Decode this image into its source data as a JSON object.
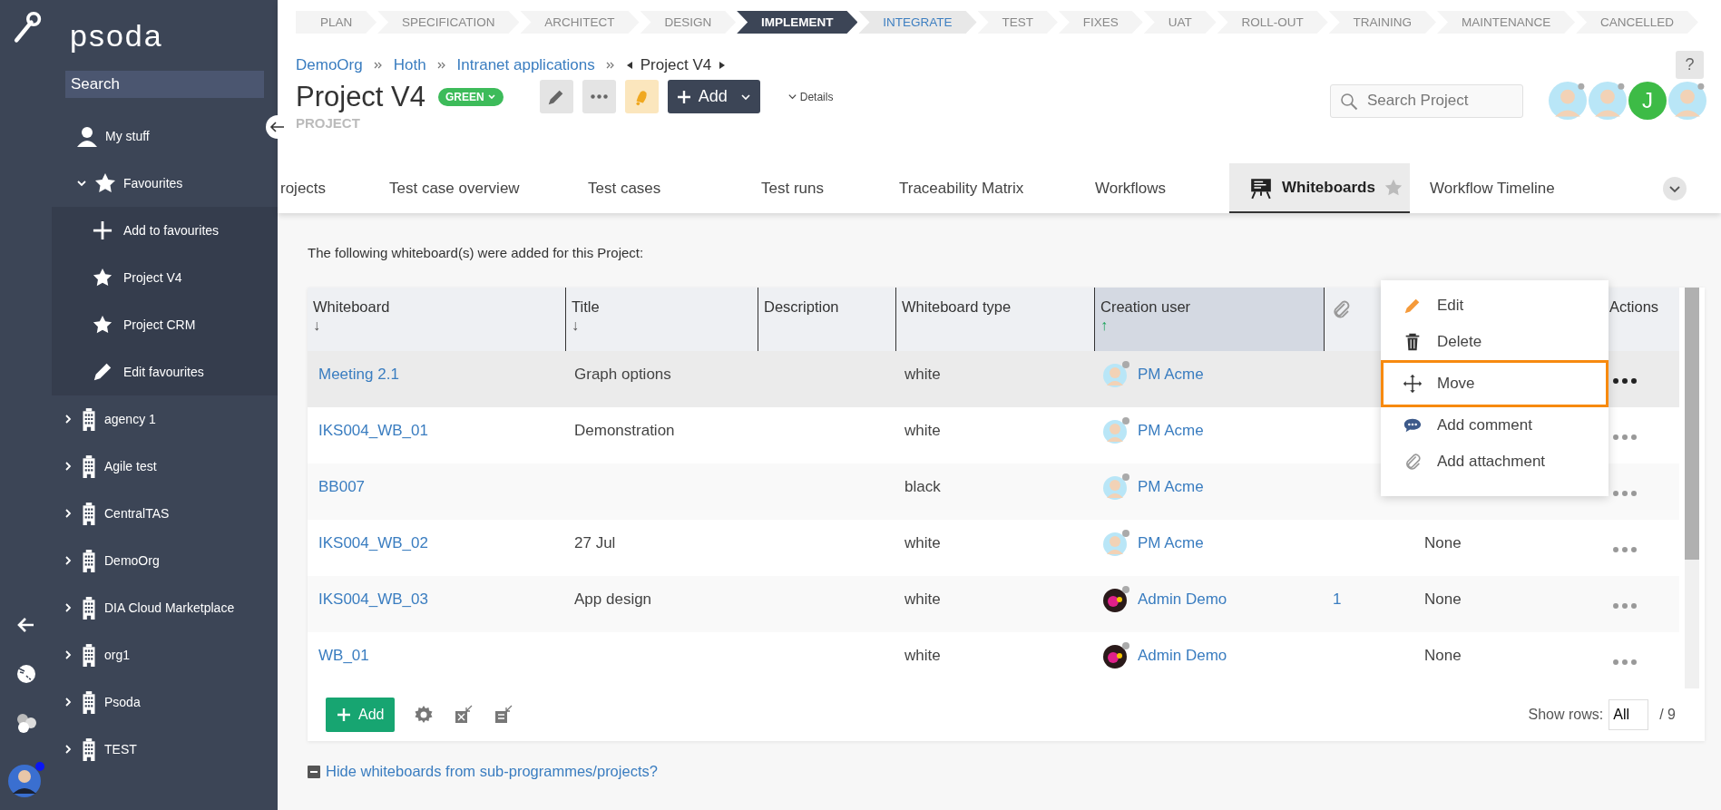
{
  "sidebar": {
    "brand": "psoda",
    "search": {
      "placeholder": "Search"
    },
    "items": [
      {
        "label": "My stuff",
        "kind": "user"
      },
      {
        "label": "Favourites",
        "kind": "star",
        "expanded": true,
        "children": [
          {
            "label": "Add to favourites",
            "kind": "plus"
          },
          {
            "label": "Project V4",
            "kind": "star"
          },
          {
            "label": "Project CRM",
            "kind": "star"
          },
          {
            "label": "Edit favourites",
            "kind": "pencil"
          }
        ]
      },
      {
        "label": "agency 1",
        "kind": "org",
        "expanded": false
      },
      {
        "label": "Agile test",
        "kind": "org",
        "expanded": false
      },
      {
        "label": "CentralTAS",
        "kind": "org",
        "expanded": false
      },
      {
        "label": "DemoOrg",
        "kind": "org",
        "expanded": false
      },
      {
        "label": "DIA Cloud Marketplace",
        "kind": "org",
        "expanded": false
      },
      {
        "label": "org1",
        "kind": "org",
        "expanded": false
      },
      {
        "label": "Psoda",
        "kind": "org",
        "expanded": false
      },
      {
        "label": "TEST",
        "kind": "org",
        "expanded": false
      }
    ]
  },
  "stages": [
    {
      "label": "PLAN",
      "selected": false,
      "highlighted": false
    },
    {
      "label": "SPECIFICATION",
      "selected": false,
      "highlighted": false
    },
    {
      "label": "ARCHITECT",
      "selected": false,
      "highlighted": false
    },
    {
      "label": "DESIGN",
      "selected": false,
      "highlighted": false
    },
    {
      "label": "IMPLEMENT",
      "selected": true,
      "highlighted": false
    },
    {
      "label": "INTEGRATE",
      "selected": false,
      "highlighted": true
    },
    {
      "label": "TEST",
      "selected": false,
      "highlighted": false
    },
    {
      "label": "FIXES",
      "selected": false,
      "highlighted": false
    },
    {
      "label": "UAT",
      "selected": false,
      "highlighted": false
    },
    {
      "label": "ROLL-OUT",
      "selected": false,
      "highlighted": false
    },
    {
      "label": "TRAINING",
      "selected": false,
      "highlighted": false
    },
    {
      "label": "MAINTENANCE",
      "selected": false,
      "highlighted": false
    },
    {
      "label": "CANCELLED",
      "selected": false,
      "highlighted": false
    }
  ],
  "breadcrumb": [
    {
      "label": "DemoOrg",
      "kind": "link"
    },
    {
      "label": "Hoth",
      "kind": "link"
    },
    {
      "label": "Intranet applications",
      "kind": "link"
    },
    {
      "label": "Project V4",
      "kind": "current"
    }
  ],
  "help": "?",
  "project": {
    "title": "Project V4",
    "status": "GREEN",
    "type": "PROJECT",
    "add_label": "Add",
    "details_label": "Details"
  },
  "search_project": {
    "placeholder": "Search Project"
  },
  "members": [
    {
      "kind": "avatar"
    },
    {
      "kind": "avatar"
    },
    {
      "kind": "initial",
      "initial": "J"
    },
    {
      "kind": "avatar"
    }
  ],
  "tabs": [
    {
      "label": "rojects",
      "selected": false
    },
    {
      "label": "Test case overview",
      "selected": false
    },
    {
      "label": "Test cases",
      "selected": false
    },
    {
      "label": "Test runs",
      "selected": false
    },
    {
      "label": "Traceability Matrix",
      "selected": false
    },
    {
      "label": "Workflows",
      "selected": false
    },
    {
      "label": "Whiteboards",
      "selected": true
    },
    {
      "label": "Workflow Timeline",
      "selected": false
    }
  ],
  "intro": "The following whiteboard(s) were added for this Project:",
  "table": {
    "columns": [
      {
        "label": "Whiteboard",
        "sort_mark": "↓",
        "sorted": false
      },
      {
        "label": "Title",
        "sort_mark": "↓",
        "sorted": false
      },
      {
        "label": "Description"
      },
      {
        "label": "Whiteboard type"
      },
      {
        "label": "Creation user",
        "sort_mark": "↑",
        "sorted": true
      },
      {
        "kind": "attachment"
      },
      {
        "kind": "blank"
      },
      {
        "label": "Actions"
      }
    ],
    "rows": [
      {
        "whiteboard": "Meeting 2.1",
        "title": "Graph options",
        "type": "white",
        "user": "PM Acme",
        "avatar": {
          "kind": "person"
        },
        "selected": true
      },
      {
        "whiteboard": "IKS004_WB_01",
        "title": "Demonstration",
        "type": "white",
        "user": "PM Acme",
        "avatar": {
          "kind": "person"
        },
        "selected": false
      },
      {
        "whiteboard": "BB007",
        "type": "black",
        "user": "PM Acme",
        "avatar": {
          "kind": "person"
        },
        "selected": false
      },
      {
        "whiteboard": "IKS004_WB_02",
        "title": "27 Jul",
        "type": "white",
        "user": "PM Acme",
        "avatar": {
          "kind": "person"
        },
        "column_7": "None",
        "selected": false
      },
      {
        "whiteboard": "IKS004_WB_03",
        "title": "App design",
        "type": "white",
        "user": "Admin Demo",
        "attachments": "1",
        "column_7": "None",
        "selected": false
      },
      {
        "whiteboard": "WB_01",
        "type": "white",
        "user": "Admin Demo",
        "column_7": "None",
        "selected": false
      }
    ]
  },
  "context_menu": {
    "items": [
      {
        "label": "Edit",
        "kind": "edit",
        "selected": false
      },
      {
        "label": "Delete",
        "kind": "delete",
        "selected": false
      },
      {
        "label": "Move",
        "kind": "move",
        "selected": true
      },
      {
        "label": "Add comment",
        "kind": "comment",
        "selected": false
      },
      {
        "label": "Add attachment",
        "kind": "attachment",
        "selected": false
      }
    ]
  },
  "footer": {
    "add_label": "Add",
    "show_rows_label": "Show rows:",
    "rows_value": "All",
    "total": "/ 9"
  },
  "hide_link": "Hide whiteboards from sub-programmes/projects?"
}
